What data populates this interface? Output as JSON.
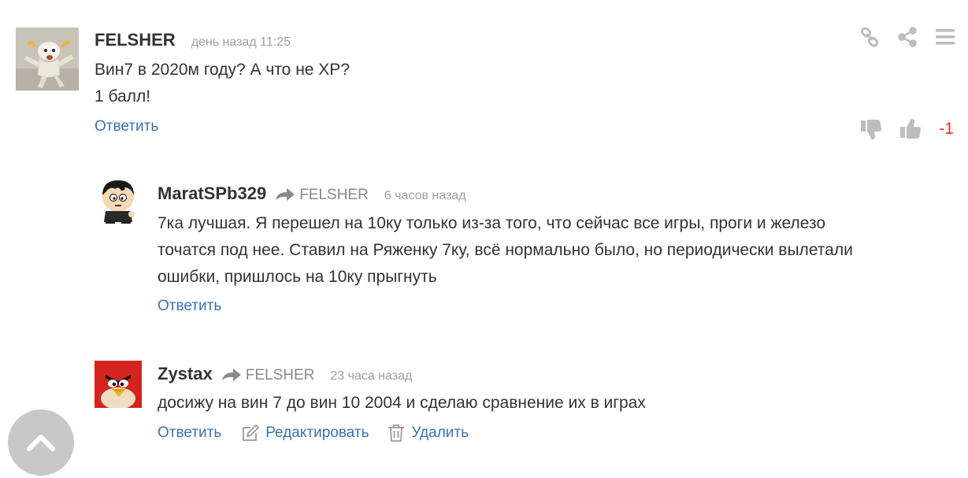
{
  "comments": [
    {
      "author": "FELSHER",
      "time": "день назад 11:25",
      "lines": [
        "Вин7 в 2020м году? А что не XP?",
        "1 балл!"
      ],
      "actions": {
        "reply": "Ответить"
      },
      "score": "-1",
      "avatar_icon": "white-creature-avatar"
    },
    {
      "author": "MaratSPb329",
      "reply_to": "FELSHER",
      "time": "6 часов назад",
      "lines": [
        "7ка лучшая. Я перешел на 10ку только из-за того, что сейчас все игры, проги и железо",
        "точатся под нее. Ставил на Ряженку 7ку, всё нормально было, но периодически вылетали",
        "ошибки, пришлось на 10ку прыгнуть"
      ],
      "actions": {
        "reply": "Ответить"
      },
      "avatar_icon": "cartoon-boy-avatar"
    },
    {
      "author": "Zystax",
      "reply_to": "FELSHER",
      "time": "23 часа назад",
      "lines": [
        "досижу на вин 7 до вин 10 2004 и сделаю сравнение их в играх"
      ],
      "actions": {
        "reply": "Ответить",
        "edit": "Редактировать",
        "delete": "Удалить"
      },
      "avatar_icon": "red-angry-bird-avatar"
    }
  ],
  "colors": {
    "link": "#3b73af",
    "score_negative": "#e0302c",
    "muted": "#8a8a8a",
    "icon_gray": "#bdbdbd"
  }
}
